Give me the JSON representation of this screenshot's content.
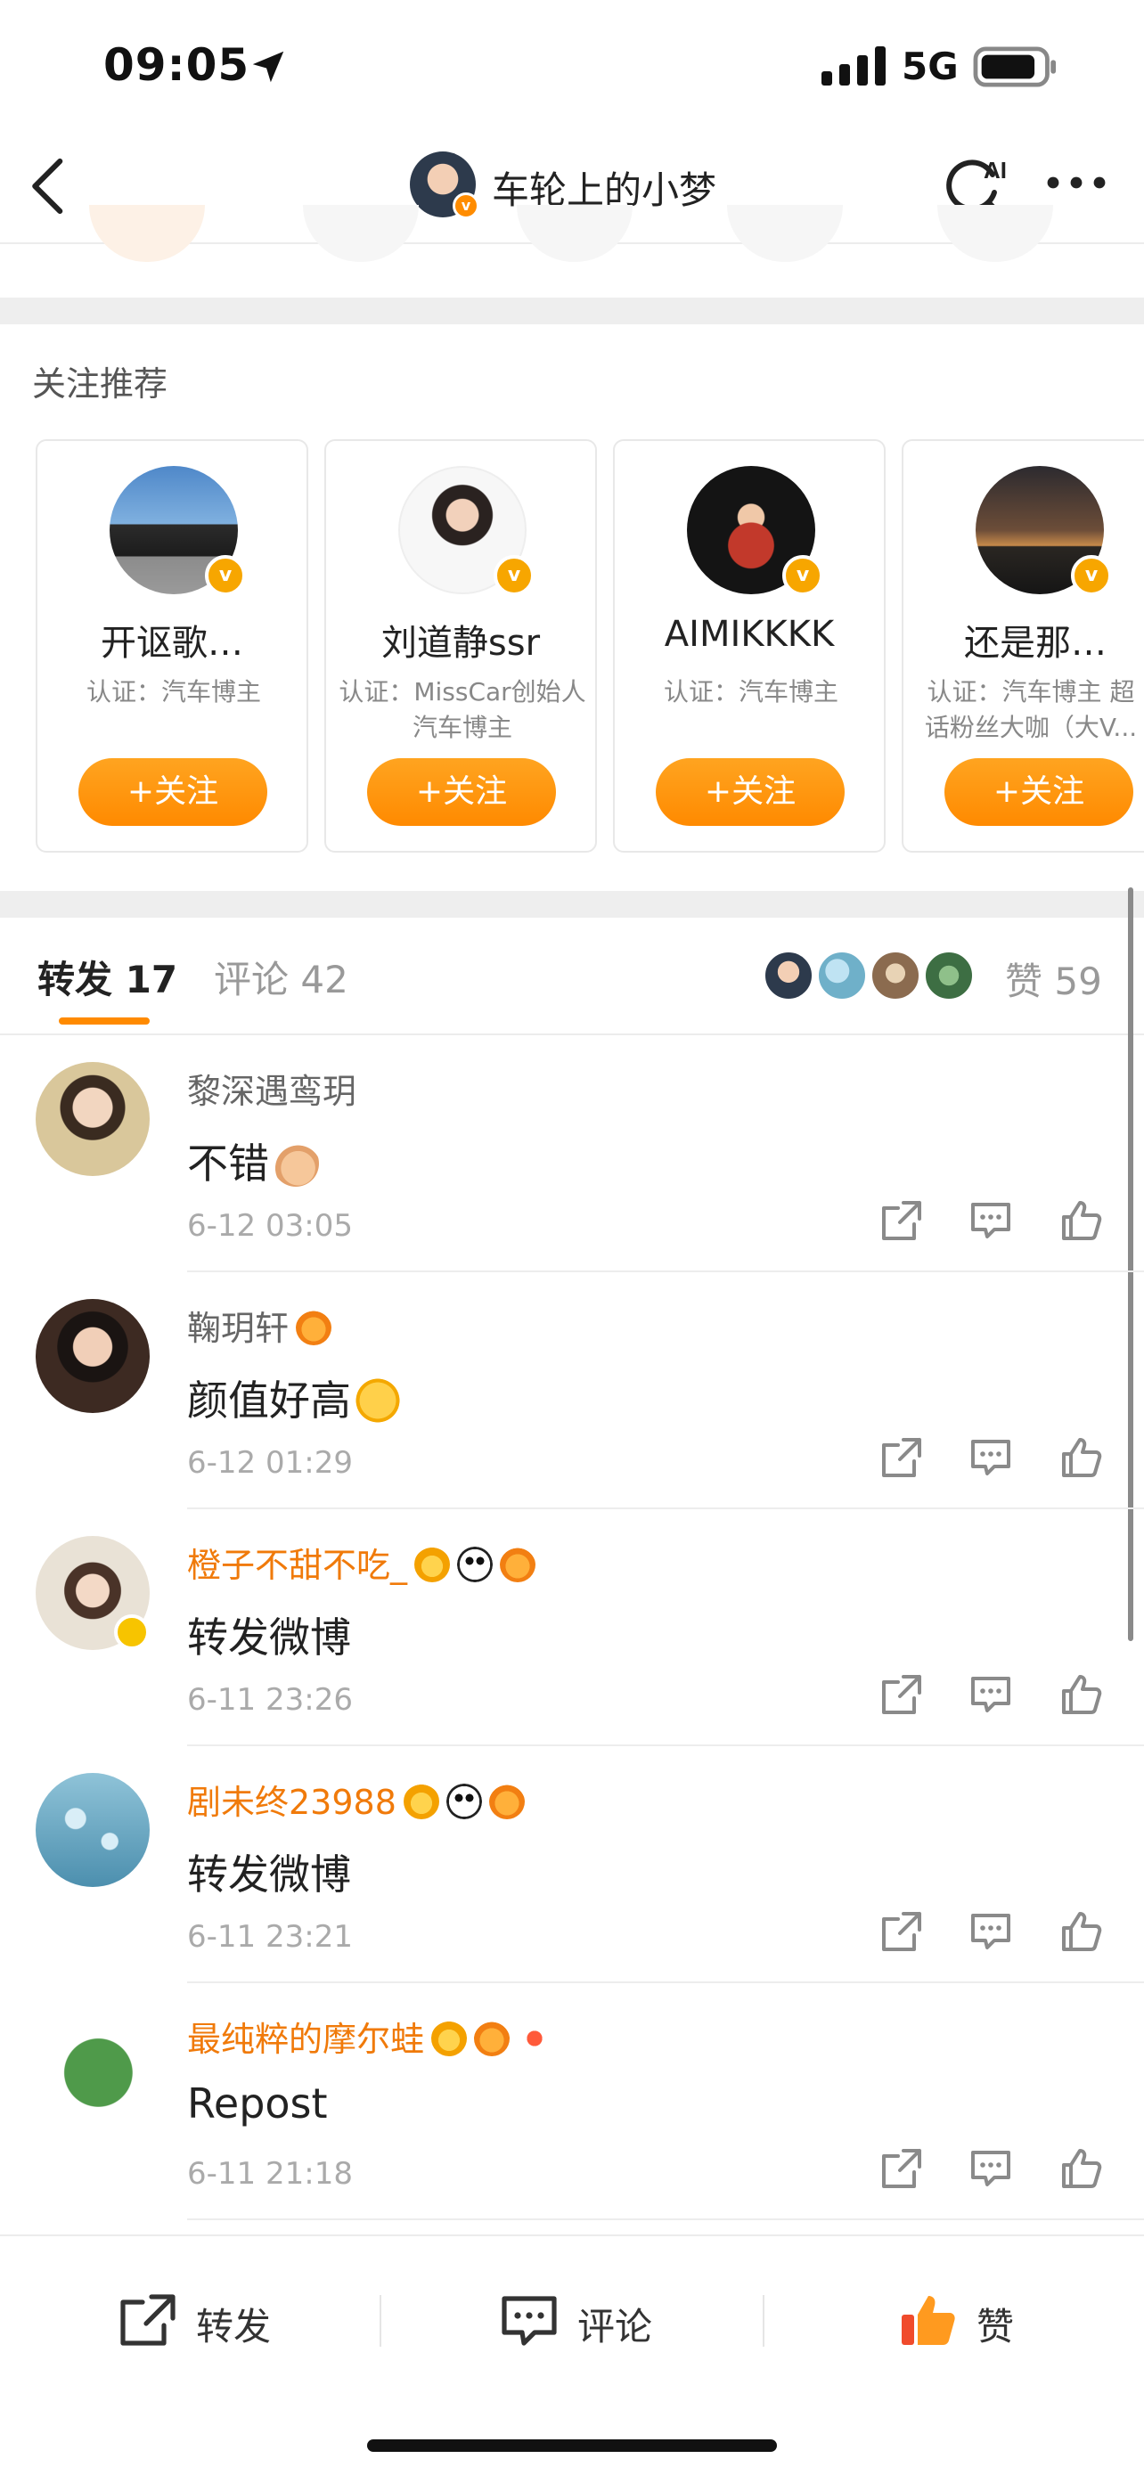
{
  "status_bar": {
    "time": "09:05",
    "network": "5G"
  },
  "nav": {
    "title": "车轮上的小梦",
    "ai_label": "AI"
  },
  "recommendations": {
    "title": "关注推荐",
    "follow_label": "+关注",
    "cards": [
      {
        "name": "开讴歌…",
        "cert": "认证：汽车博主"
      },
      {
        "name": "刘道静ssr",
        "cert": "认证：MissCar创始人 汽车博主"
      },
      {
        "name": "AIMIKKKK",
        "cert": "认证：汽车博主"
      },
      {
        "name": "还是那…",
        "cert": "认证：汽车博主 超话粉丝大咖（大V..."
      }
    ]
  },
  "tabs": {
    "repost": "转发 17",
    "comment": "评论 42",
    "likes": "赞 59"
  },
  "reposts": [
    {
      "name": "黎深遇鸾玥",
      "text": "不错",
      "time": "6-12 03:05"
    },
    {
      "name": "鞠玥轩",
      "text": "颜值好高",
      "time": "6-12 01:29"
    },
    {
      "name": "橙子不甜不吃_",
      "text": "转发微博",
      "time": "6-11 23:26"
    },
    {
      "name": "剧未终23988",
      "text": "转发微博",
      "time": "6-11 23:21"
    },
    {
      "name": "最纯粹的摩尔蛙",
      "text": "Repost",
      "time": "6-11 21:18"
    }
  ],
  "bottom_bar": {
    "repost": "转发",
    "comment": "评论",
    "like": "赞"
  },
  "colors": {
    "accent": "#ff8a00",
    "vip_name": "#f07a0a",
    "like_red": "#f04b2c"
  },
  "icons": [
    "location-arrow-icon",
    "signal-icon",
    "battery-icon",
    "back-icon",
    "ai-search-icon",
    "more-icon",
    "share-icon",
    "comment-icon",
    "thumbs-up-icon"
  ]
}
